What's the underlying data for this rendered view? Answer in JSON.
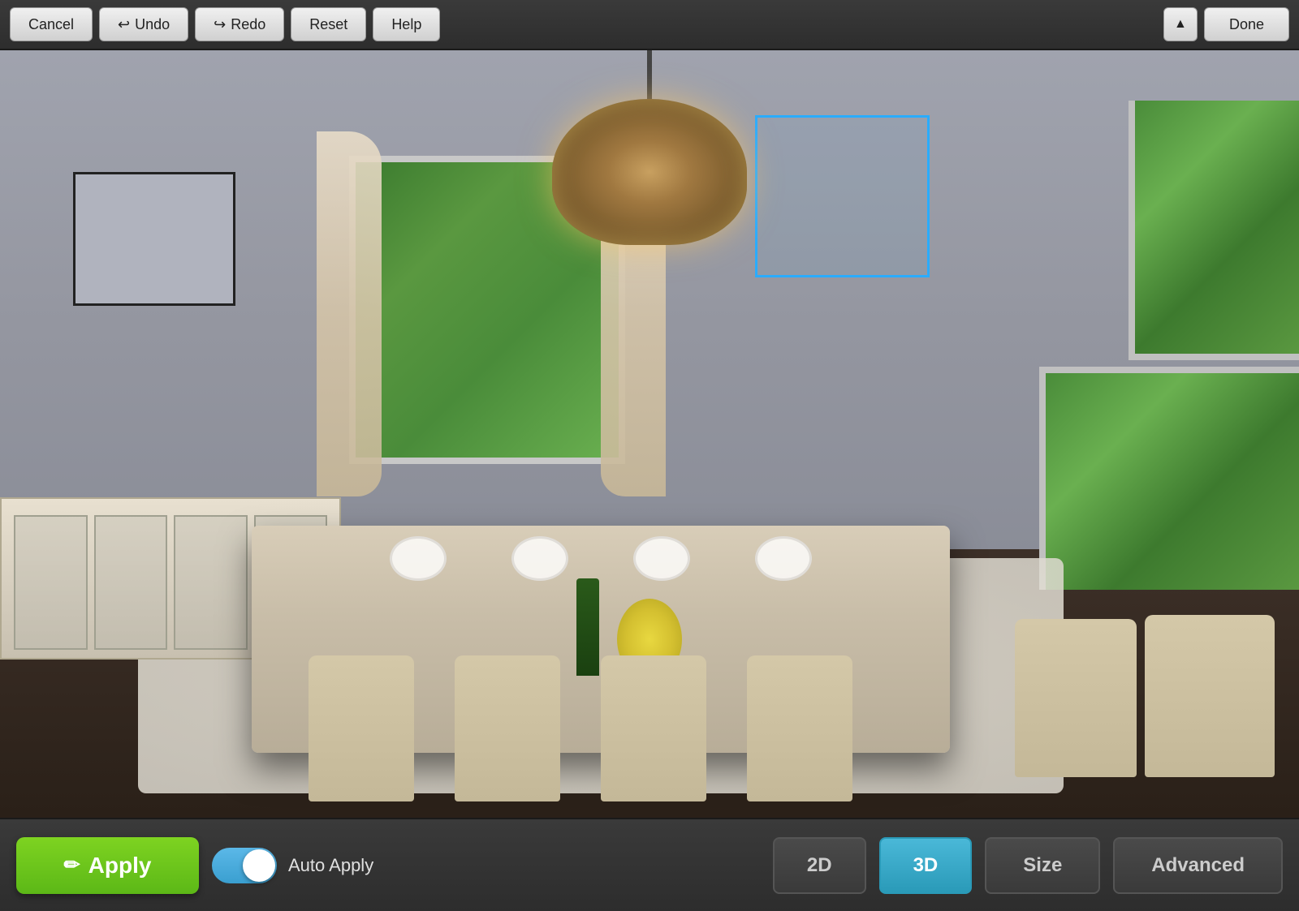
{
  "toolbar": {
    "cancel_label": "Cancel",
    "undo_label": "Undo",
    "redo_label": "Redo",
    "reset_label": "Reset",
    "help_label": "Help",
    "done_label": "Done",
    "collapse_icon": "▲"
  },
  "bottom_bar": {
    "apply_label": "Apply",
    "apply_icon": "✎",
    "auto_apply_label": "Auto Apply",
    "mode_2d_label": "2D",
    "mode_3d_label": "3D",
    "size_label": "Size",
    "advanced_label": "Advanced"
  },
  "scene": {
    "selection_box_visible": true,
    "picture_frame_visible": true
  },
  "icons": {
    "undo": "↩",
    "redo": "↪",
    "pencil": "✏"
  }
}
